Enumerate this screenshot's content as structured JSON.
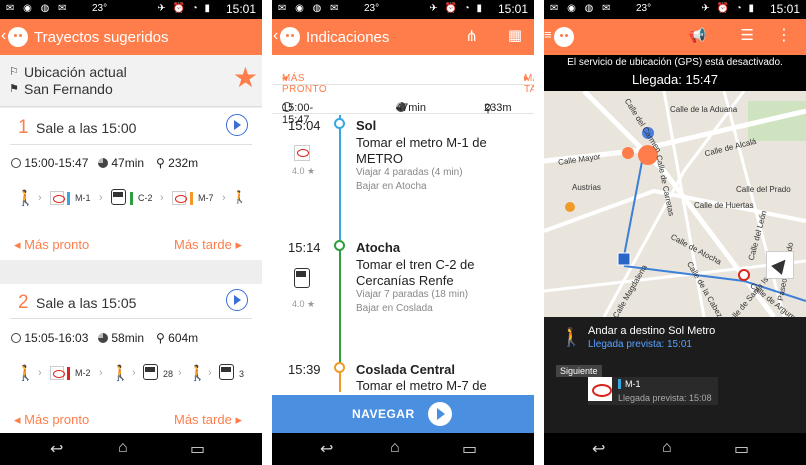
{
  "status_bar": {
    "temp": "23°",
    "time": "15:01"
  },
  "screen1": {
    "title": "Trayectos sugeridos",
    "origin": "Ubicación actual",
    "destination": "San Fernando",
    "routes": [
      {
        "num": "1",
        "departure": "Sale a las 15:00",
        "times": "15:00-15:47",
        "duration": "47min",
        "walk": "232m",
        "legs": [
          {
            "type": "metro",
            "line": "M-1",
            "color": "#38a7e0"
          },
          {
            "type": "train",
            "line": "C-2",
            "color": "#2e9e3e"
          },
          {
            "type": "metro",
            "line": "M-7",
            "color": "#f19a2a"
          }
        ],
        "earlier": "Más pronto",
        "later": "Más tarde"
      },
      {
        "num": "2",
        "departure": "Sale a las 15:05",
        "times": "15:05-16:03",
        "duration": "58min",
        "walk": "604m",
        "legs": [
          {
            "type": "metro",
            "line": "M-2",
            "color": "#d9261c"
          },
          {
            "type": "bus",
            "line": "28"
          },
          {
            "type": "bus",
            "line": "3"
          }
        ],
        "earlier": "Más pronto",
        "later": "Más tarde"
      }
    ]
  },
  "screen2": {
    "title": "Indicaciones",
    "earlier": "MÁS PRONTO",
    "later": "MÁS TARDE",
    "summary": {
      "times": "15:00-15:47",
      "duration": "47min",
      "walk": "233m"
    },
    "steps": [
      {
        "time": "15:04",
        "stop": "Sol",
        "instruction": "Tomar el metro M-1 de METRO",
        "stops": "Viajar 4 paradas (4 min)",
        "getoff": "Bajar en Atocha",
        "rating": "4.0 ★",
        "color": "#38a7e0"
      },
      {
        "time": "15:14",
        "stop": "Atocha",
        "instruction": "Tomar el tren C-2 de Cercanías Renfe",
        "stops": "Viajar 7 paradas (18 min)",
        "getoff": "Bajar en Coslada",
        "rating": "4.0 ★",
        "color": "#2e9e3e"
      },
      {
        "time": "15:39",
        "stop": "Coslada Central",
        "instruction": "Tomar el metro M-7 de",
        "color": "#f19a2a"
      }
    ],
    "navigate": "NAVEGAR"
  },
  "screen3": {
    "gps_msg": "El servicio de ubicación (GPS) está desactivado.",
    "arrival": "Llegada: 15:47",
    "streets": [
      "Calle de la Aduana",
      "Calle Mayor",
      "Calle del Carmen",
      "Calle de Alcalá",
      "Calle de Carretas",
      "Calle de Atocha",
      "Calle del Prado",
      "Calle de Huertas",
      "Calle del León",
      "Calle de Argumosa",
      "Calle de la Cabeza",
      "Calle de Santa Isabel",
      "Calle Magdalena",
      "Austrias",
      "Paseo del Prado"
    ],
    "next_action": "Andar a destino Sol Metro",
    "expected": "Llegada prevista: 15:01",
    "siguiente": "Siguiente",
    "next_line": "M-1",
    "next_arrival": "Llegada prevista: 15:08"
  }
}
